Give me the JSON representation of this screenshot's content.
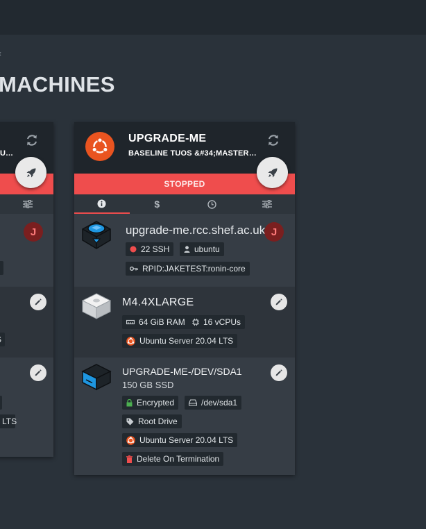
{
  "page": {
    "breadcrumb": "‹",
    "title": "MACHINES"
  },
  "left_card": {
    "image_fragment": "U…",
    "ram_fragment": "S",
    "os_fragment": "LTS"
  },
  "machine": {
    "name": "UPGRADE-ME",
    "image": "BASELINE TUOS &#34;MASTER…",
    "status": "STOPPED",
    "tabs": [
      {
        "name": "info",
        "icon": "info-icon"
      },
      {
        "name": "cost",
        "icon": "dollar-icon"
      },
      {
        "name": "schedule",
        "icon": "clock-icon"
      },
      {
        "name": "settings",
        "icon": "sliders-icon"
      }
    ],
    "hostname": "upgrade-me.rcc.shef.ac.uk",
    "owner_initial": "J",
    "ssh_port": "22 SSH",
    "ssh_user": "ubuntu",
    "rpid": "RPID:JAKETEST:ronin-core",
    "instance_type": "M4.4XLARGE",
    "ram": "64 GiB RAM",
    "vcpus": "16 vCPUs",
    "os": "Ubuntu Server 20.04 LTS",
    "disk": {
      "name": "UPGRADE-ME-/DEV/SDA1",
      "size": "150 GB SSD",
      "encrypted": "Encrypted",
      "device": "/dev/sda1",
      "root": "Root Drive",
      "os": "Ubuntu Server 20.04 LTS",
      "delete": "Delete On Termination"
    }
  },
  "colors": {
    "background": "#2a323a",
    "card": "#363d45",
    "card_header": "#1f252b",
    "status_stopped": "#ef4d4d",
    "ubuntu": "#e95420",
    "avatar": "#7a1f1f",
    "server_blue": "#1e96e0"
  }
}
